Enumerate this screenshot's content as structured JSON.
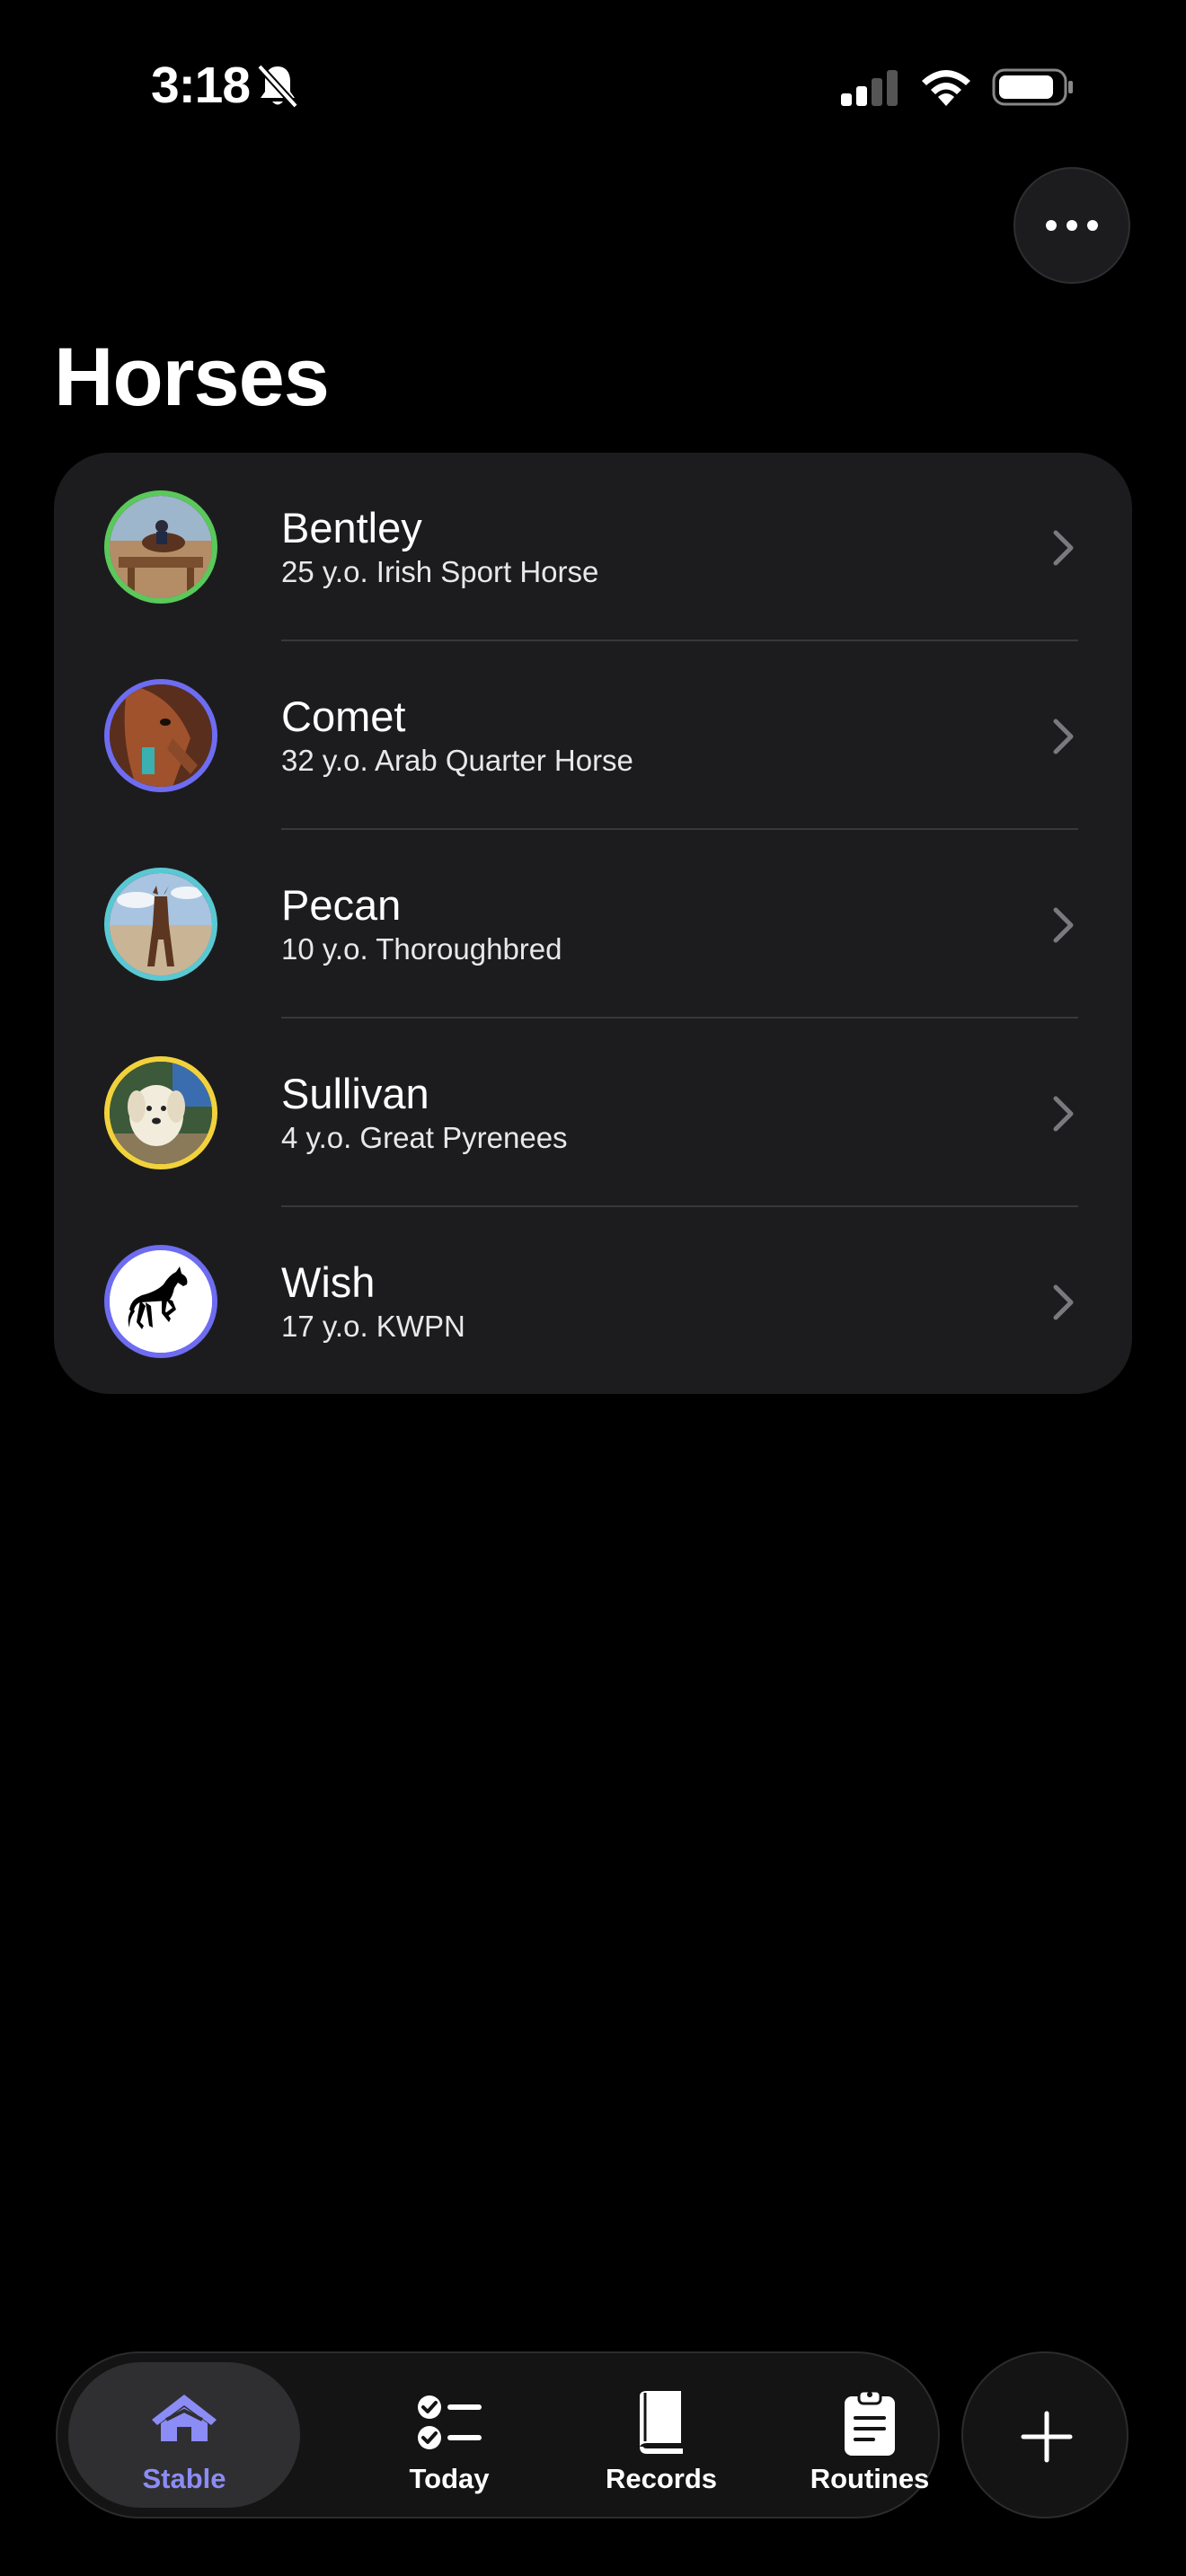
{
  "status_bar": {
    "time": "3:18",
    "icons": [
      "bell-slash-icon",
      "cellular-signal-icon",
      "wifi-icon",
      "battery-icon"
    ]
  },
  "header": {
    "title": "Horses",
    "more_icon": "ellipsis-icon"
  },
  "horses": [
    {
      "name": "Bentley",
      "subtitle": "25 y.o. Irish Sport Horse",
      "ring_color": "#5ac85a",
      "avatar": "photo-rider-jumping"
    },
    {
      "name": "Comet",
      "subtitle": "32 y.o. Arab Quarter Horse",
      "ring_color": "#6e6cf0",
      "avatar": "photo-chestnut-horse"
    },
    {
      "name": "Pecan",
      "subtitle": "10 y.o. Thoroughbred",
      "ring_color": "#5ac8d2",
      "avatar": "photo-bay-horse-arena"
    },
    {
      "name": "Sullivan",
      "subtitle": "4 y.o. Great Pyrenees",
      "ring_color": "#f2d23c",
      "avatar": "photo-white-dog"
    },
    {
      "name": "Wish",
      "subtitle": "17 y.o. KWPN",
      "ring_color": "#6e6cf0",
      "avatar": "horse-silhouette-icon"
    }
  ],
  "tab_bar": {
    "tabs": [
      {
        "label": "Stable",
        "icon": "stable-icon",
        "active": true
      },
      {
        "label": "Today",
        "icon": "checklist-icon",
        "active": false
      },
      {
        "label": "Records",
        "icon": "book-icon",
        "active": false
      },
      {
        "label": "Routines",
        "icon": "clipboard-icon",
        "active": false
      }
    ],
    "add_icon": "plus-icon"
  },
  "colors": {
    "accent": "#8b8cf5",
    "background": "#000000",
    "card": "#1c1c1e"
  }
}
